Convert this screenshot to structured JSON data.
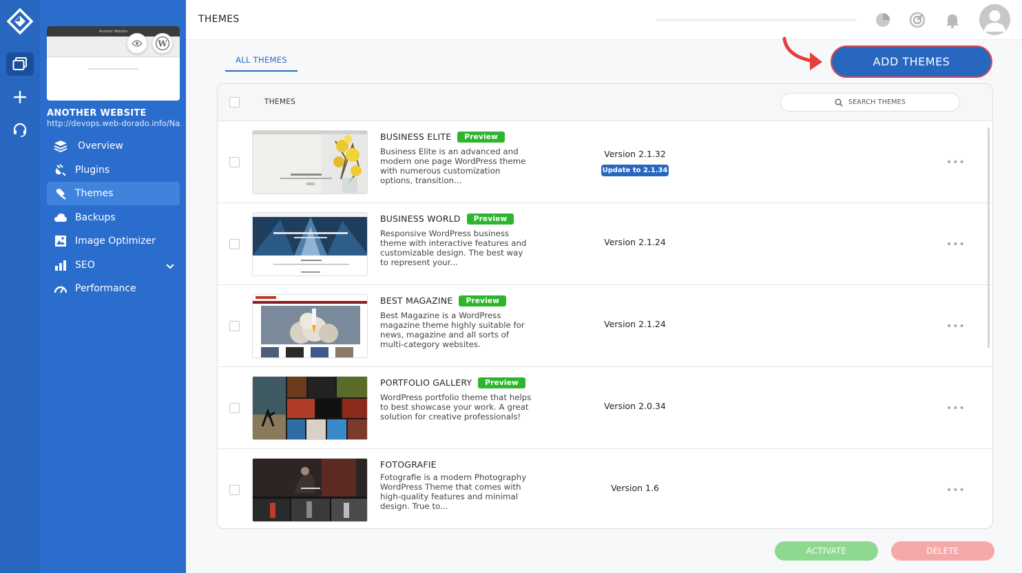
{
  "rail": {
    "icons": [
      "logo-icon",
      "websites-icon",
      "add-icon",
      "support-icon"
    ]
  },
  "sidebar": {
    "site_name": "ANOTHER WEBSITE",
    "site_url": "http://devops.web-dorado.info/Na...",
    "thumb_title": "Another Website",
    "items": [
      {
        "label": "Overview",
        "icon": "layers-icon"
      },
      {
        "label": "Plugins",
        "icon": "plug-icon"
      },
      {
        "label": "Themes",
        "icon": "brush-icon",
        "active": true
      },
      {
        "label": "Backups",
        "icon": "cloud-icon"
      },
      {
        "label": "Image Optimizer",
        "icon": "image-icon"
      },
      {
        "label": "SEO",
        "icon": "bars-icon"
      },
      {
        "label": "Performance",
        "icon": "gauge-icon"
      }
    ]
  },
  "topbar": {
    "title": "THEMES"
  },
  "tabs": {
    "all_label": "ALL THEMES"
  },
  "actions": {
    "add_label": "ADD THEMES",
    "activate_label": "ACTIVATE",
    "delete_label": "DELETE"
  },
  "table": {
    "header_label": "THEMES",
    "search_placeholder": "SEARCH THEMES",
    "preview_label": "Preview",
    "rows": [
      {
        "name": "BUSINESS ELITE",
        "preview": true,
        "description": "Business Elite is an advanced and modern one page WordPress theme with numerous customization options, transition...",
        "version": "Version 2.1.32",
        "update": "Update to 2.1.34"
      },
      {
        "name": "BUSINESS WORLD",
        "preview": true,
        "description": "Responsive WordPress business theme with interactive features and customizable design. The best way to represent your...",
        "version": "Version 2.1.24"
      },
      {
        "name": "BEST MAGAZINE",
        "preview": true,
        "description": "Best Magazine is a WordPress magazine theme highly suitable for news, magazine and all sorts of multi-category websites.",
        "version": "Version 2.1.24"
      },
      {
        "name": "PORTFOLIO GALLERY",
        "preview": true,
        "description": "WordPress portfolio theme that helps to best showcase your work. A great solution for creative professionals!",
        "version": "Version 2.0.34"
      },
      {
        "name": "FOTOGRAFIE",
        "preview": false,
        "description": "Fotografie is a modern Photography WordPress Theme that comes with high-quality features and minimal design. True to...",
        "version": "Version 1.6"
      }
    ]
  },
  "colors": {
    "rail": "#2767c0",
    "sidebar": "#2b6dcd",
    "accent": "#2767c0",
    "preview_badge": "#2db52d",
    "highlight_border": "#e4474a"
  }
}
